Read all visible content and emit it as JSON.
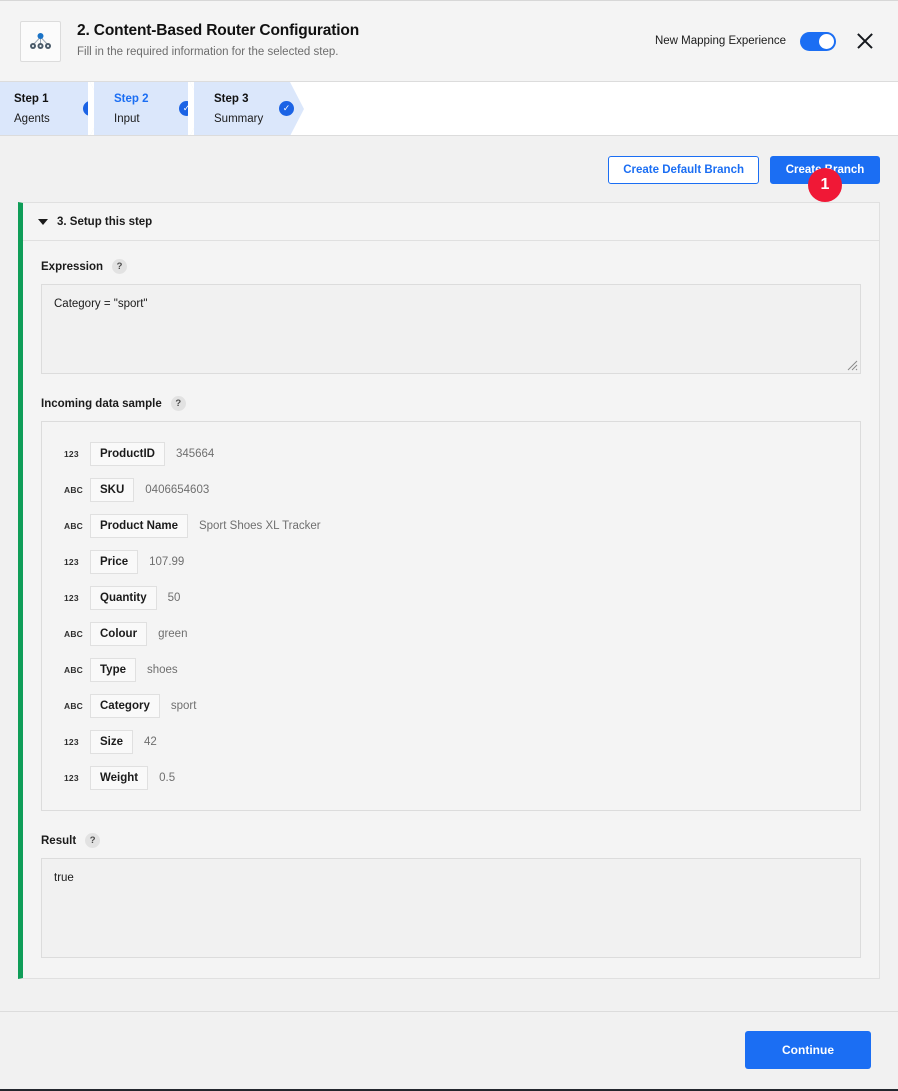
{
  "header": {
    "icon": "router-tree-icon",
    "title": "2. Content-Based Router Configuration",
    "subtitle": "Fill in the required information for the selected step.",
    "toggle_label": "New Mapping Experience",
    "toggle_on": true,
    "close_icon": "close-icon",
    "accent_blue": "#1b6ef3"
  },
  "steps": [
    {
      "name": "Step 1",
      "desc": "Agents",
      "check": "✓",
      "active": false
    },
    {
      "name": "Step 2",
      "desc": "Input",
      "check": "✓",
      "active": true
    },
    {
      "name": "Step 3",
      "desc": "Summary",
      "check": "✓",
      "active": false
    }
  ],
  "actions": {
    "default_branch_label": "Create Default Branch",
    "create_branch_label": "Create Branch",
    "annotation_badge": "1",
    "badge_color": "#f01836"
  },
  "panel": {
    "title": "3. Setup this step",
    "accent_color": "#0f9d58",
    "expression": {
      "label": "Expression",
      "help": "?",
      "value": "Category = \"sport\""
    },
    "sample": {
      "label": "Incoming data sample",
      "help": "?",
      "rows": [
        {
          "type": "123",
          "field": "ProductID",
          "value": "345664"
        },
        {
          "type": "ABC",
          "field": "SKU",
          "value": "0406654603"
        },
        {
          "type": "ABC",
          "field": "Product Name",
          "value": "Sport Shoes XL Tracker"
        },
        {
          "type": "123",
          "field": "Price",
          "value": "107.99"
        },
        {
          "type": "123",
          "field": "Quantity",
          "value": "50"
        },
        {
          "type": "ABC",
          "field": "Colour",
          "value": "green"
        },
        {
          "type": "ABC",
          "field": "Type",
          "value": "shoes"
        },
        {
          "type": "ABC",
          "field": "Category",
          "value": "sport"
        },
        {
          "type": "123",
          "field": "Size",
          "value": "42"
        },
        {
          "type": "123",
          "field": "Weight",
          "value": "0.5"
        }
      ]
    },
    "result": {
      "label": "Result",
      "help": "?",
      "value": "true"
    }
  },
  "footer": {
    "continue_label": "Continue"
  }
}
